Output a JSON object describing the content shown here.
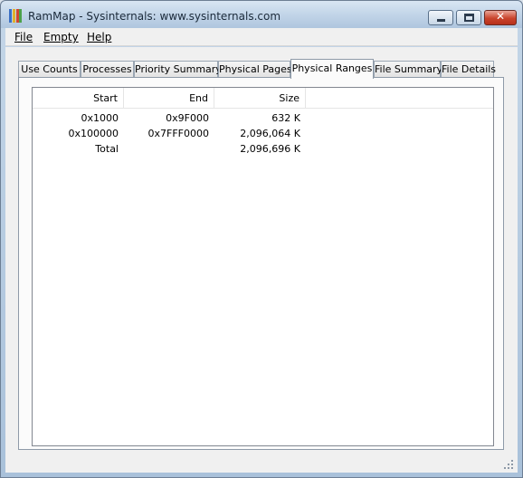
{
  "window": {
    "title": "RamMap - Sysinternals: www.sysinternals.com",
    "controls": {
      "minimize": "minimize",
      "maximize": "maximize",
      "close": "x"
    }
  },
  "menu": [
    {
      "label": "File"
    },
    {
      "label": "Empty"
    },
    {
      "label": "Help"
    }
  ],
  "tabs": [
    {
      "label": "Use Counts",
      "active": false
    },
    {
      "label": "Processes",
      "active": false
    },
    {
      "label": "Priority Summary",
      "active": false
    },
    {
      "label": "Physical Pages",
      "active": false
    },
    {
      "label": "Physical Ranges",
      "active": true
    },
    {
      "label": "File Summary",
      "active": false
    },
    {
      "label": "File Details",
      "active": false
    }
  ],
  "table": {
    "columns": [
      "Start",
      "End",
      "Size"
    ],
    "rows": [
      [
        "0x1000",
        "0x9F000",
        "632 K"
      ],
      [
        "0x100000",
        "0x7FFF0000",
        "2,096,064 K"
      ],
      [
        "Total",
        "",
        "2,096,696 K"
      ]
    ]
  },
  "colors": {
    "title_bar": "#c2d5e8",
    "close_button": "#c9442c",
    "app_icon": [
      "#3a6fc4",
      "#e0b12a",
      "#d2452f",
      "#4ca24b"
    ]
  }
}
